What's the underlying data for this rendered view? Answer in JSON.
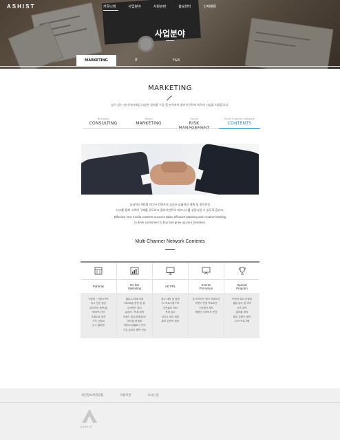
{
  "header": {
    "logo": "ASHIST",
    "nav": [
      "커뮤니케",
      "사업분야",
      "사원관련",
      "홍보센터",
      "인재채용"
    ]
  },
  "hero": {
    "title": "사업분야"
  },
  "tabs": [
    "MARKETING",
    "IT",
    "F&B"
  ],
  "intro": {
    "title": "MARKETING",
    "description": "성이 있는 미디어/마케팅 다양한 정보를 수집 및 분석하여 클라이언트에 최적의 사업을 지원합니다."
  },
  "categories": [
    {
      "small": "Business",
      "large": "CONSULTING"
    },
    {
      "small": "Brand",
      "large": "MARKETING"
    },
    {
      "small": "Online",
      "large": "RISK MANAGEMENT"
    },
    {
      "small": "Multi Channer Network",
      "large": "CONTENTS"
    }
  ],
  "body": {
    "ko_line1": "효과적인 MCN 미디어 컨텐츠의 성공은 효율적인 계획 및 창의적인",
    "ko_line2": "사고를 통해 고객의 구매를 유도하고 클라이언트의 비즈니스를 성장시킬 수 있도록 합니다.",
    "en_line1": "Effective mcn media contents success takes effective planning and creative thinking",
    "en_line2": "to drive customers to buy and grow up your business."
  },
  "mcn": {
    "title": "Multi Channer Network Contents",
    "columns": [
      {
        "icon": "star-grid-icon",
        "label": "Publicity",
        "items": [
          "언론보 / 언론보 PR",
          "미# 관련 생성",
          "온오프라 제목/결",
          "하이PR 관리",
          "조별소로 제작",
          "기자 간담회",
          "뉴스 클리핑"
        ]
      },
      {
        "icon": "bar-chart-icon",
        "label": "On-line\nMarketing",
        "items": [
          "블로그/카페 리뷰",
          "SNS채널 운영 및 홍",
          "검색엔진 광고",
          "유튜브 / 틱톡 제작",
          "키워드 광고(파워링크)",
          "바이럴 마케팅",
          "커뮤니티/블로그 관리",
          "기업 온라인 평판 관리"
        ]
      },
      {
        "icon": "monitor-icon",
        "label": "AD PPL",
        "items": [
          "광고 제작 및 집행",
          "TV 프로그램 PPL",
          "신문홍보 제작",
          "옥외 광고",
          "라디오 제작 제휴",
          "홍보 콘텐츠 제작"
        ]
      },
      {
        "icon": "presentation-icon",
        "label": "Events\nPromotion",
        "items": [
          "온·오프라인 행사 프로모션",
          "브랜드 런칭 프로모션",
          "기업행사 제작",
          "체험단 서포터즈 운영"
        ]
      },
      {
        "icon": "trophy-icon",
        "label": "Special\nProgram",
        "items": [
          "브랜딩 특허 컨설팅",
          "셀럽 섭외 및 계약",
          "굿즈 제작",
          "홍보물 제작",
          "홍보 콘텐츠 제작",
          "CSR 프로그램"
        ]
      }
    ]
  },
  "footer": {
    "links": [
      "개인정보처리방침",
      "이용약관",
      "오시는길"
    ],
    "logo_text": "ASHIST"
  }
}
